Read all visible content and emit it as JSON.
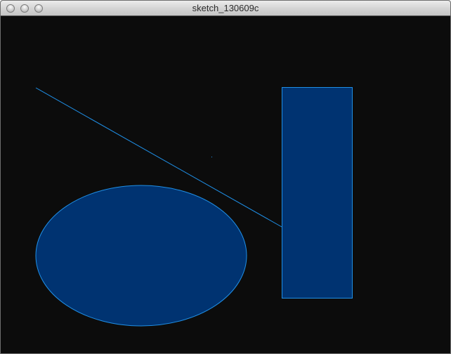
{
  "window": {
    "title": "sketch_130609c"
  },
  "colors": {
    "background": "#0c0c0c",
    "shape_fill": "#003371",
    "stroke": "#1f8fe6"
  }
}
